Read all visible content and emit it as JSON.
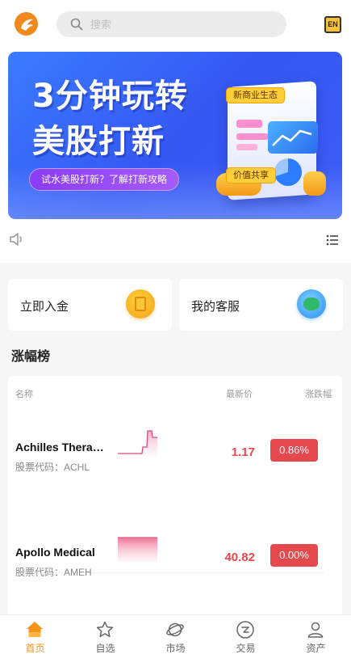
{
  "header": {
    "search_placeholder": "搜索",
    "lang_label": "EN"
  },
  "banner": {
    "title_line1": "3分钟玩转",
    "title_line2": "美股打新",
    "subtitle": "试水美股打新？了解打新攻略",
    "tag1": "新商业生态",
    "tag2": "价值共享"
  },
  "quick_actions": [
    {
      "label": "立即入金",
      "icon": "gold-deposit-icon"
    },
    {
      "label": "我的客服",
      "icon": "customer-service-icon"
    }
  ],
  "rankings": {
    "title": "涨幅榜",
    "columns": {
      "name": "名称",
      "price": "最新价",
      "change": "涨跌幅"
    },
    "rows": [
      {
        "name": "Achilles Therapeutics",
        "code_label": "股票代码：ACHL",
        "price": "1.17",
        "change": "0.86%"
      },
      {
        "name": "Apollo Medical",
        "code_label": "股票代码：AMEH",
        "price": "40.82",
        "change": "0.00%"
      }
    ]
  },
  "tabbar": [
    {
      "label": "首页",
      "icon": "home-icon",
      "active": true
    },
    {
      "label": "自选",
      "icon": "star-icon",
      "active": false
    },
    {
      "label": "市场",
      "icon": "planet-icon",
      "active": false
    },
    {
      "label": "交易",
      "icon": "trade-icon",
      "active": false
    },
    {
      "label": "资产",
      "icon": "user-icon",
      "active": false
    }
  ],
  "colors": {
    "accent": "#f39418",
    "up_red": "#e5484d",
    "banner_blue": "#3558f2"
  }
}
